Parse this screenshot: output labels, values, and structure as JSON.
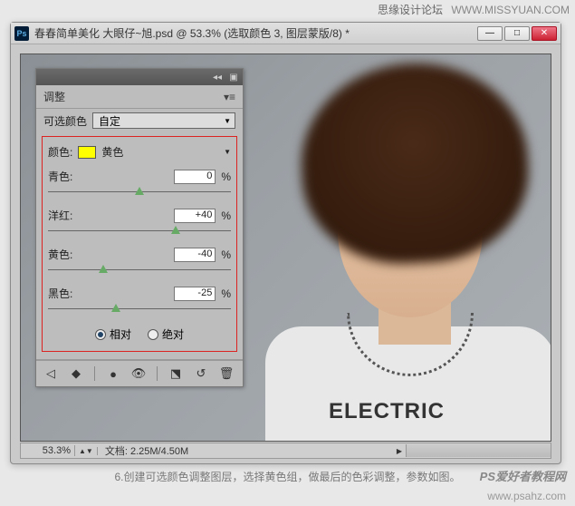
{
  "watermark": {
    "top_cn": "思缘设计论坛",
    "top_url": "WWW.MISSYUAN.COM",
    "footer_brand": "PS爱好者教程网",
    "footer_url": "www.psahz.com"
  },
  "window": {
    "title": "春春简单美化 大眼仔~旭.psd @ 53.3% (选取颜色 3, 图层蒙版/8) *",
    "minimize": "—",
    "maximize": "□",
    "close": "✕"
  },
  "panel": {
    "tab": "调整",
    "preset_label": "可选颜色",
    "preset_value": "自定",
    "color_label": "颜色:",
    "color_name": "黄色",
    "color_swatch": "#ffff00",
    "sliders": [
      {
        "label": "青色:",
        "value": "0",
        "pos": 50
      },
      {
        "label": "洋红:",
        "value": "+40",
        "pos": 70
      },
      {
        "label": "黄色:",
        "value": "-40",
        "pos": 30
      },
      {
        "label": "黑色:",
        "value": "-25",
        "pos": 37
      }
    ],
    "pct": "%",
    "radio_rel": "相对",
    "radio_abs": "绝对",
    "radio_checked": "rel"
  },
  "status": {
    "zoom": "53.3%",
    "doc": "文档: 2.25M/4.50M"
  },
  "shirt_text": "ELECTRIC",
  "caption": "6.创建可选颜色调整图层，选择黄色组，做最后的色彩调整，参数如图。"
}
